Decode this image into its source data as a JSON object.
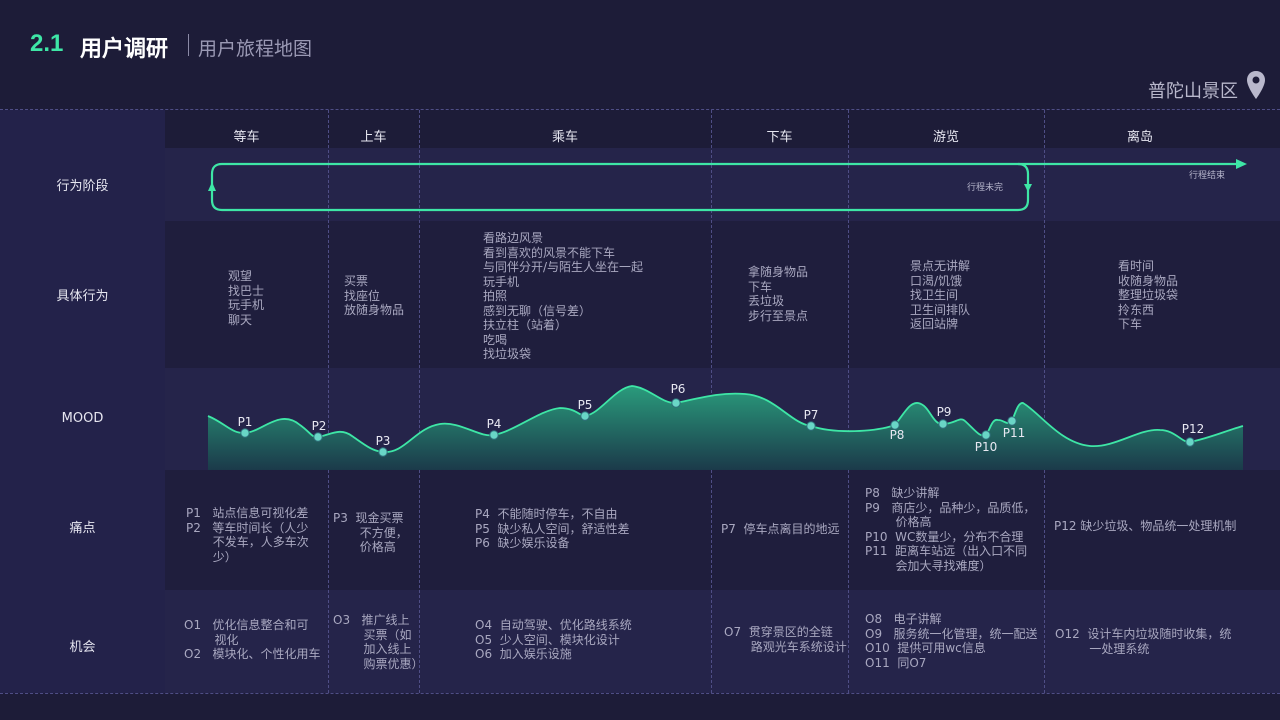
{
  "header": {
    "section_number": "2.1",
    "title": "用户调研",
    "subtitle": "用户旅程地图",
    "location": "普陀山景区"
  },
  "stages": [
    "等车",
    "上车",
    "乘车",
    "下车",
    "游览",
    "离岛"
  ],
  "row_labels": {
    "behavior_stage": "行为阶段",
    "actions": "具体行为",
    "mood": "MOOD",
    "pain_points": "痛点",
    "opportunities": "机会"
  },
  "flow": {
    "loop_label": "行程未完",
    "end_label": "行程结束"
  },
  "actions": [
    "观望\n找巴士\n玩手机\n聊天",
    "买票\n找座位\n放随身物品",
    "看路边风景\n看到喜欢的风景不能下车\n与同伴分开/与陌生人坐在一起\n玩手机\n拍照\n感到无聊（信号差）\n扶立柱（站着）\n吃喝\n找垃圾袋",
    "拿随身物品\n下车\n丢垃圾\n步行至景点",
    "景点无讲解\n口渴/饥饿\n找卫生间\n卫生间排队\n返回站牌",
    "看时间\n收随身物品\n整理垃圾袋\n拎东西\n下车"
  ],
  "mood_points": [
    {
      "label": "P1"
    },
    {
      "label": "P2"
    },
    {
      "label": "P3"
    },
    {
      "label": "P4"
    },
    {
      "label": "P5"
    },
    {
      "label": "P6"
    },
    {
      "label": "P7"
    },
    {
      "label": "P8"
    },
    {
      "label": "P9"
    },
    {
      "label": "P10"
    },
    {
      "label": "P11"
    },
    {
      "label": "P12"
    }
  ],
  "pain_points": [
    "P1   站点信息可视化差\nP2   等车时间长（人少\n       不发车，人多车次\n       少）",
    "P3  现金买票\n       不方便，\n       价格高",
    "P4  不能随时停车，不自由\nP5  缺少私人空间，舒适性差\nP6  缺少娱乐设备",
    "P7  停车点离目的地远",
    "P8   缺少讲解\nP9   商店少，品种少，品质低，\n        价格高\nP10  WC数量少，分布不合理\nP11  距离车站远（出入口不同\n        会加大寻找难度）",
    "P12 缺少垃圾、物品统一处理机制"
  ],
  "opportunities": [
    "O1   优化信息整合和可\n        视化\nO2   模块化、个性化用车",
    "O3   推广线上\n        买票（如\n        加入线上\n        购票优惠）",
    "O4  自动驾驶、优化路线系统\nO5  少人空间、模块化设计\nO6  加入娱乐设施",
    "O7  贯穿景区的全链\n       路观光车系统设计",
    "O8   电子讲解\nO9   服务统一化管理，统一配送\nO10  提供可用wc信息\nO11  同O7",
    "O12  设计车内垃圾随时收集，统\n         一处理系统"
  ],
  "colors": {
    "background": "#1d1c38",
    "band": "#25244a",
    "accent": "#3ee6a6",
    "dashed_line": "#4f4e86",
    "point": "#69d6c6"
  },
  "icons": {
    "location": "map-pin-icon",
    "flow": "loop-arrow-icon"
  }
}
